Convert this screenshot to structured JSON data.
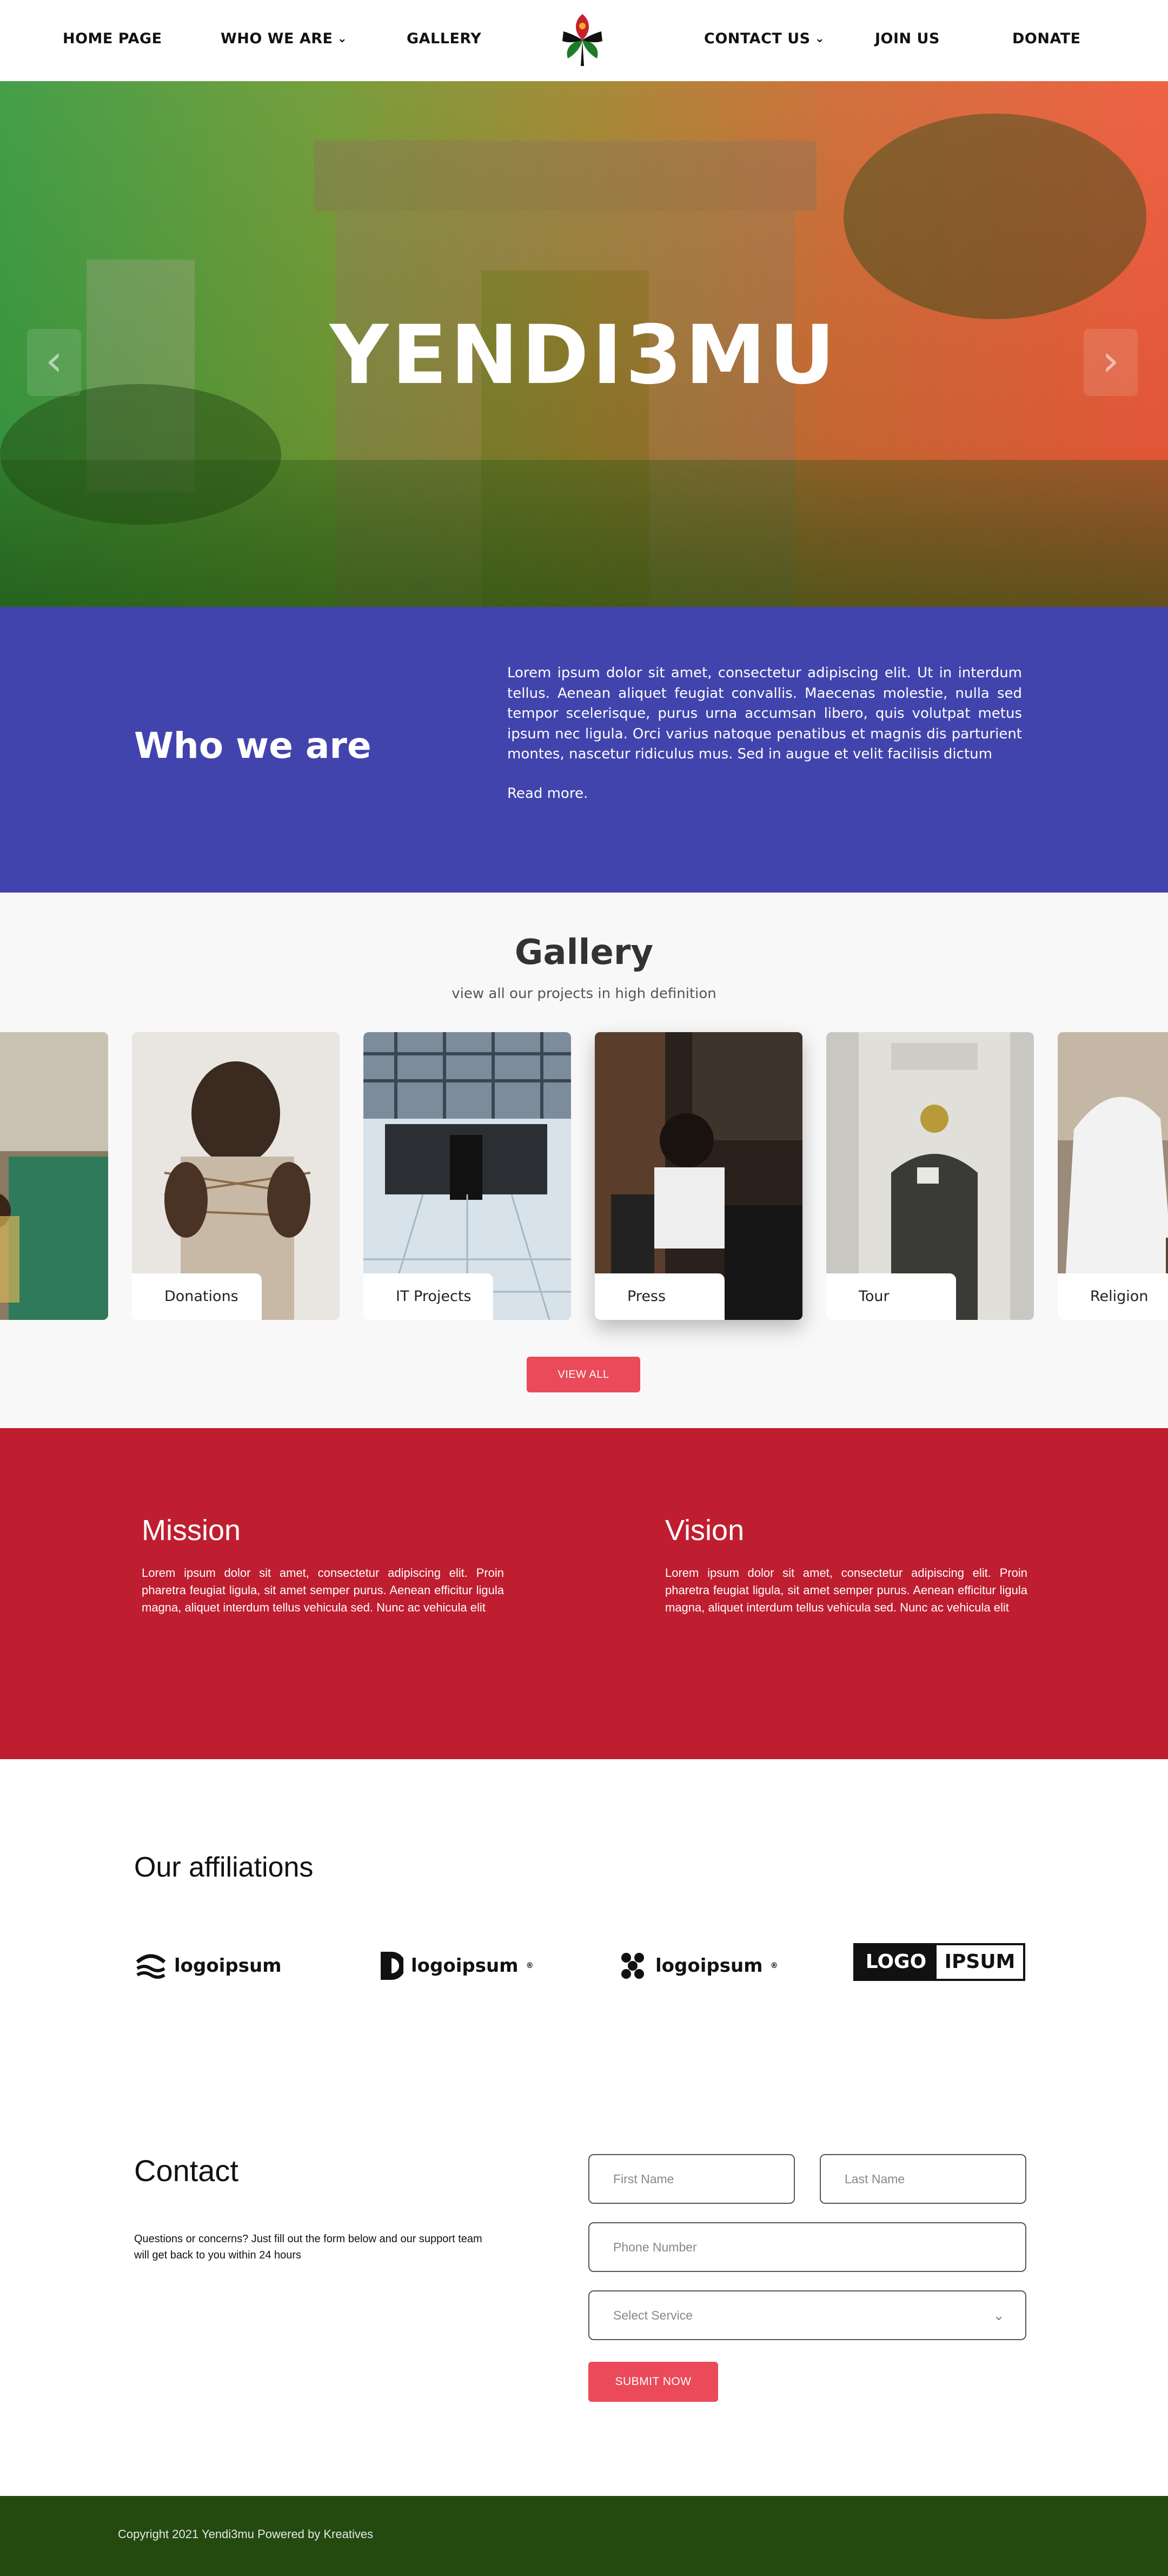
{
  "nav": {
    "items": [
      {
        "label": "HOME PAGE",
        "dropdown": false
      },
      {
        "label": "WHO WE ARE",
        "dropdown": true
      },
      {
        "label": "GALLERY",
        "dropdown": false
      },
      {
        "label": "CONTACT US",
        "dropdown": true
      },
      {
        "label": "JOIN US",
        "dropdown": false
      },
      {
        "label": "DONATE",
        "dropdown": false
      }
    ],
    "chevron": "⌄"
  },
  "hero": {
    "title": "YENDI3MU",
    "prev_arrow": "‹",
    "next_arrow": "›",
    "gradient_start": "#3a9a40",
    "gradient_end": "#ee5a3a"
  },
  "who": {
    "heading": "Who we are",
    "body": "Lorem ipsum dolor sit amet, consectetur adipiscing elit. Ut in interdum tellus. Aenean aliquet feugiat convallis. Maecenas molestie, nulla sed tempor scelerisque, purus urna accumsan libero, quis volutpat metus ipsum nec ligula. Orci varius natoque penatibus et magnis dis parturient montes, nascetur ridiculus mus. Sed in augue et velit facilisis dictum",
    "read_more": "Read more.",
    "background": "#4244ad"
  },
  "gallery": {
    "heading": "Gallery",
    "subheading": "view all our projects in high definition",
    "cards": [
      {
        "label": "",
        "image": "classroom-children"
      },
      {
        "label": "Donations",
        "image": "child-string-game"
      },
      {
        "label": "IT Projects",
        "image": "data-center"
      },
      {
        "label": "Press",
        "image": "radio-studio",
        "active": true
      },
      {
        "label": "Tour",
        "image": "castle-doorway"
      },
      {
        "label": "Religion",
        "image": "white-veil"
      }
    ],
    "view_all": "VIEW ALL"
  },
  "mission": {
    "heading": "Mission",
    "body": "Lorem ipsum dolor sit amet, consectetur adipiscing elit. Proin pharetra feugiat ligula, sit amet semper purus. Aenean efficitur ligula magna, aliquet interdum tellus vehicula sed. Nunc ac vehicula elit"
  },
  "vision": {
    "heading": "Vision",
    "body": "Lorem ipsum dolor sit amet, consectetur adipiscing elit. Proin pharetra feugiat ligula, sit amet semper purus. Aenean efficitur ligula magna, aliquet interdum tellus vehicula sed. Nunc ac vehicula elit"
  },
  "affiliations": {
    "heading": "Our affiliations",
    "logos": [
      {
        "text": "logoipsum",
        "icon": "waves-icon"
      },
      {
        "text": "logoipsum",
        "icon": "half-circle-icon",
        "mark": "®"
      },
      {
        "text": "logoipsum",
        "icon": "dots-icon",
        "mark": "®"
      },
      {
        "text_a": "LOGO",
        "text_b": "IPSUM"
      }
    ]
  },
  "contact": {
    "heading": "Contact",
    "intro": "Questions or concerns? Just fill out the form below and our support team will get back to you within 24 hours",
    "first_name_placeholder": "First Name",
    "last_name_placeholder": "Last Name",
    "phone_placeholder": "Phone Number",
    "service_placeholder": "Select Service",
    "submit": "SUBMIT NOW",
    "accent": "#ea4a5a"
  },
  "footer": {
    "copyright": "Copyright 2021 Yendi3mu Powered by Kreatives",
    "background": "#244a10"
  }
}
